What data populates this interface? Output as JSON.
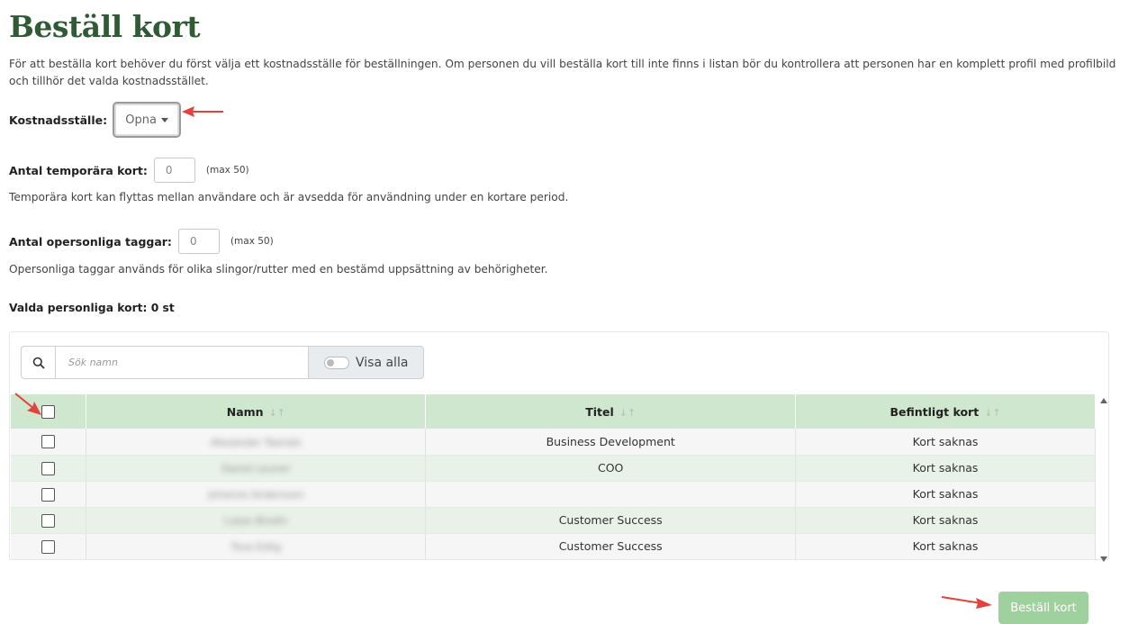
{
  "page": {
    "title": "Beställ kort",
    "intro": "För att beställa kort behöver du först välja ett kostnadsställe för beställningen. Om personen du vill beställa kort till inte finns i listan bör du kontrollera att personen har en komplett profil med profilbild och tillhör det valda kostnadsstället."
  },
  "cost_center": {
    "label": "Kostnadsställe:",
    "value": "Opna"
  },
  "temp_cards": {
    "label": "Antal temporära kort:",
    "value": "0",
    "max": "(max 50)",
    "help": "Temporära kort kan flyttas mellan användare och är avsedda för användning under en kortare period."
  },
  "tags": {
    "label": "Antal opersonliga taggar:",
    "value": "0",
    "max": "(max 50)",
    "help": "Opersonliga taggar används för olika slingor/rutter med en bestämd uppsättning av behörigheter."
  },
  "selected": {
    "label": "Valda personliga kort: 0 st"
  },
  "search": {
    "placeholder": "Sök namn",
    "toggle_label": "Visa alla"
  },
  "table": {
    "headers": {
      "name": "Namn",
      "title": "Titel",
      "card": "Befintligt kort"
    },
    "rows": [
      {
        "name": "Alexander Taanals",
        "title": "Business Development",
        "card": "Kort saknas"
      },
      {
        "name": "Daniel Leuner",
        "title": "COO",
        "card": "Kort saknas"
      },
      {
        "name": "Johanne Anderssen",
        "title": "",
        "card": "Kort saknas"
      },
      {
        "name": "Lukas Brodin",
        "title": "Customer Success",
        "card": "Kort saknas"
      },
      {
        "name": "Tove Edlig",
        "title": "Customer Success",
        "card": "Kort saknas"
      }
    ]
  },
  "actions": {
    "order_label": "Beställ kort"
  },
  "colors": {
    "brand": "#2f5a34",
    "header_green": "#cfe6cf",
    "missing_red": "#e0314b",
    "button_green": "#9fd19f",
    "arrow_red": "#e3413a"
  }
}
